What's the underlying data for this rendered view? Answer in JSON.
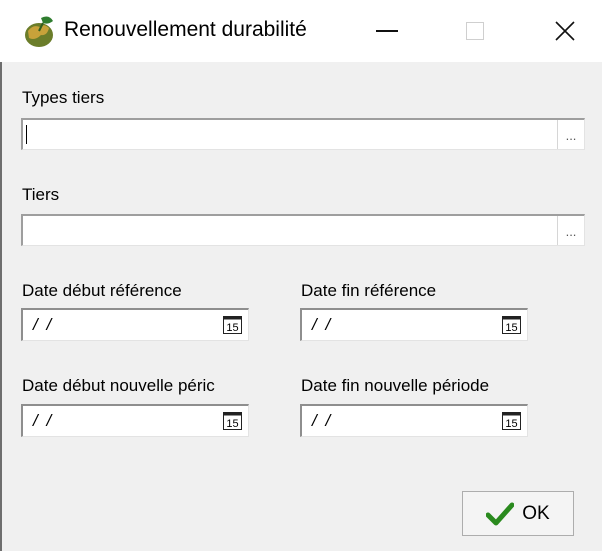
{
  "window": {
    "title": "Renouvellement durabilité",
    "icon": "app-globe-icon"
  },
  "form": {
    "types_tiers": {
      "label": "Types tiers",
      "value": "",
      "lookup_button": "..."
    },
    "tiers": {
      "label": "Tiers",
      "value": "",
      "lookup_button": "..."
    },
    "date_debut_reference": {
      "label": "Date début référence",
      "value": "/ /",
      "calendar_icon": "15"
    },
    "date_fin_reference": {
      "label": "Date fin référence",
      "value": "/ /",
      "calendar_icon": "15"
    },
    "date_debut_nouvelle": {
      "label": "Date début nouvelle péric",
      "value": "/ /",
      "calendar_icon": "15"
    },
    "date_fin_nouvelle": {
      "label": "Date fin nouvelle période",
      "value": "/ /",
      "calendar_icon": "15"
    }
  },
  "buttons": {
    "ok": {
      "label": "OK",
      "icon": "checkmark-icon"
    }
  },
  "colors": {
    "check_green": "#2a8a1e",
    "titlebar_bg": "#ffffff",
    "dialog_bg": "#f0f0f0"
  }
}
